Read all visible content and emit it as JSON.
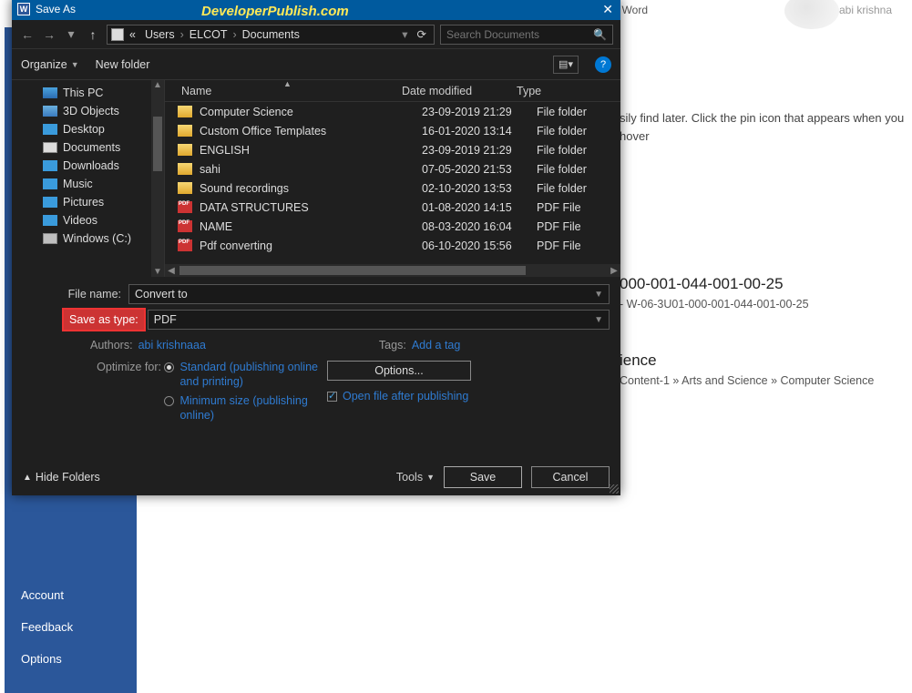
{
  "background": {
    "doc_title": "Word",
    "user_name": "abi krishna",
    "hint_text": "sily find later. Click the pin icon that appears when you hover",
    "code_line": "000-001-044-001-00-25",
    "sub_code": "- W-06-3U01-000-001-044-001-00-25",
    "location_title": "ience",
    "crumb": "Content-1 » Arts and Science » Computer Science",
    "sidebar": {
      "account": "Account",
      "feedback": "Feedback",
      "options": "Options"
    }
  },
  "dialog": {
    "title": "Save As",
    "watermark": "DeveloperPublish.com",
    "close_glyph": "✕",
    "breadcrumb": {
      "pre": "«",
      "seg1": "Users",
      "seg2": "ELCOT",
      "seg3": "Documents",
      "sep": "›"
    },
    "search_placeholder": "Search Documents",
    "organize": "Organize",
    "new_folder": "New folder",
    "view_glyph": "▤",
    "help_glyph": "?",
    "tree": [
      {
        "ico": "ico-pc",
        "label": "This PC"
      },
      {
        "ico": "ico-3d",
        "label": "3D Objects"
      },
      {
        "ico": "ico-desk",
        "label": "Desktop"
      },
      {
        "ico": "ico-doc",
        "label": "Documents"
      },
      {
        "ico": "ico-dl",
        "label": "Downloads"
      },
      {
        "ico": "ico-mus",
        "label": "Music"
      },
      {
        "ico": "ico-pic",
        "label": "Pictures"
      },
      {
        "ico": "ico-vid",
        "label": "Videos"
      },
      {
        "ico": "ico-drv",
        "label": "Windows (C:)"
      }
    ],
    "columns": {
      "name": "Name",
      "date": "Date modified",
      "type": "Type"
    },
    "files": [
      {
        "ico": "folder",
        "name": "Computer Science",
        "date": "23-09-2019 21:29",
        "type": "File folder"
      },
      {
        "ico": "folder",
        "name": "Custom Office Templates",
        "date": "16-01-2020 13:14",
        "type": "File folder"
      },
      {
        "ico": "folder",
        "name": "ENGLISH",
        "date": "23-09-2019 21:29",
        "type": "File folder"
      },
      {
        "ico": "folder",
        "name": "sahi",
        "date": "07-05-2020 21:53",
        "type": "File folder"
      },
      {
        "ico": "folder",
        "name": "Sound recordings",
        "date": "02-10-2020 13:53",
        "type": "File folder"
      },
      {
        "ico": "pdf",
        "name": "DATA STRUCTURES",
        "date": "01-08-2020 14:15",
        "type": "PDF File"
      },
      {
        "ico": "pdf",
        "name": "NAME",
        "date": "08-03-2020 16:04",
        "type": "PDF File"
      },
      {
        "ico": "pdf",
        "name": "Pdf converting",
        "date": "06-10-2020 15:56",
        "type": "PDF File"
      }
    ],
    "file_name_label": "File name:",
    "file_name_value": "Convert to",
    "save_type_label": "Save as type:",
    "save_type_value": "PDF",
    "authors_label": "Authors:",
    "authors_value": "abi krishnaaa",
    "tags_label": "Tags:",
    "tags_value": "Add a tag",
    "optimize_label": "Optimize for:",
    "opt_standard": "Standard (publishing online and printing)",
    "opt_minimum": "Minimum size (publishing online)",
    "options_btn": "Options...",
    "open_after": "Open file after publishing",
    "hide_folders": "Hide Folders",
    "tools": "Tools",
    "save": "Save",
    "cancel": "Cancel"
  }
}
